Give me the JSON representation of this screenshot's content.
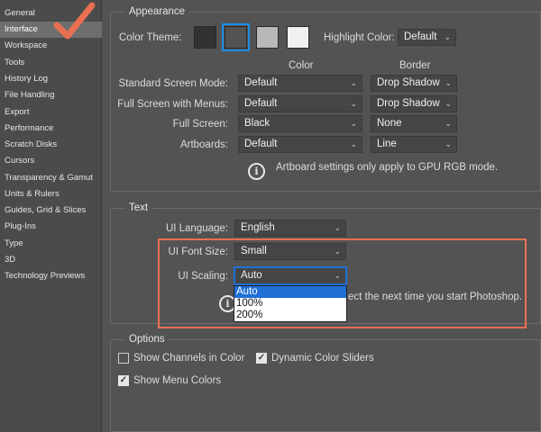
{
  "sidebar": {
    "items": [
      {
        "label": "General",
        "selected": false
      },
      {
        "label": "Interface",
        "selected": true
      },
      {
        "label": "Workspace",
        "selected": false
      },
      {
        "label": "Tools",
        "selected": false
      },
      {
        "label": "History Log",
        "selected": false
      },
      {
        "label": "File Handling",
        "selected": false
      },
      {
        "label": "Export",
        "selected": false
      },
      {
        "label": "Performance",
        "selected": false
      },
      {
        "label": "Scratch Disks",
        "selected": false
      },
      {
        "label": "Cursors",
        "selected": false
      },
      {
        "label": "Transparency & Gamut",
        "selected": false
      },
      {
        "label": "Units & Rulers",
        "selected": false
      },
      {
        "label": "Guides, Grid & Slices",
        "selected": false
      },
      {
        "label": "Plug-Ins",
        "selected": false
      },
      {
        "label": "Type",
        "selected": false
      },
      {
        "label": "3D",
        "selected": false
      },
      {
        "label": "Technology Previews",
        "selected": false
      }
    ]
  },
  "appearance": {
    "title": "Appearance",
    "color_theme_label": "Color Theme:",
    "theme_swatches": [
      {
        "name": "darkest",
        "color": "#323232",
        "selected": false
      },
      {
        "name": "dark",
        "color": "#535353",
        "selected": true
      },
      {
        "name": "light",
        "color": "#b8b8b8",
        "selected": false
      },
      {
        "name": "lightest",
        "color": "#f0f0f0",
        "selected": false
      }
    ],
    "highlight_color_label": "Highlight Color:",
    "highlight_color_value": "Default",
    "col_color": "Color",
    "col_border": "Border",
    "rows": [
      {
        "label": "Standard Screen Mode:",
        "color": "Default",
        "border": "Drop Shadow"
      },
      {
        "label": "Full Screen with Menus:",
        "color": "Default",
        "border": "Drop Shadow"
      },
      {
        "label": "Full Screen:",
        "color": "Black",
        "border": "None"
      },
      {
        "label": "Artboards:",
        "color": "Default",
        "border": "Line"
      }
    ],
    "artboard_note": "Artboard settings only apply to GPU RGB mode."
  },
  "text": {
    "title": "Text",
    "ui_language_label": "UI Language:",
    "ui_language_value": "English",
    "ui_font_size_label": "UI Font Size:",
    "ui_font_size_value": "Small",
    "ui_scaling_label": "UI Scaling:",
    "ui_scaling_value": "Auto",
    "ui_scaling_options": [
      "Auto",
      "100%",
      "200%"
    ],
    "restart_note": "ect the next time you start Photoshop."
  },
  "options": {
    "title": "Options",
    "show_channels_label": "Show Channels in Color",
    "show_channels_checked": false,
    "dynamic_sliders_label": "Dynamic Color Sliders",
    "dynamic_sliders_checked": true,
    "show_menu_colors_label": "Show Menu Colors",
    "show_menu_colors_checked": true
  },
  "colors": {
    "annotation_accent": "#e96f53",
    "focus_blue": "#1f6fd6"
  }
}
